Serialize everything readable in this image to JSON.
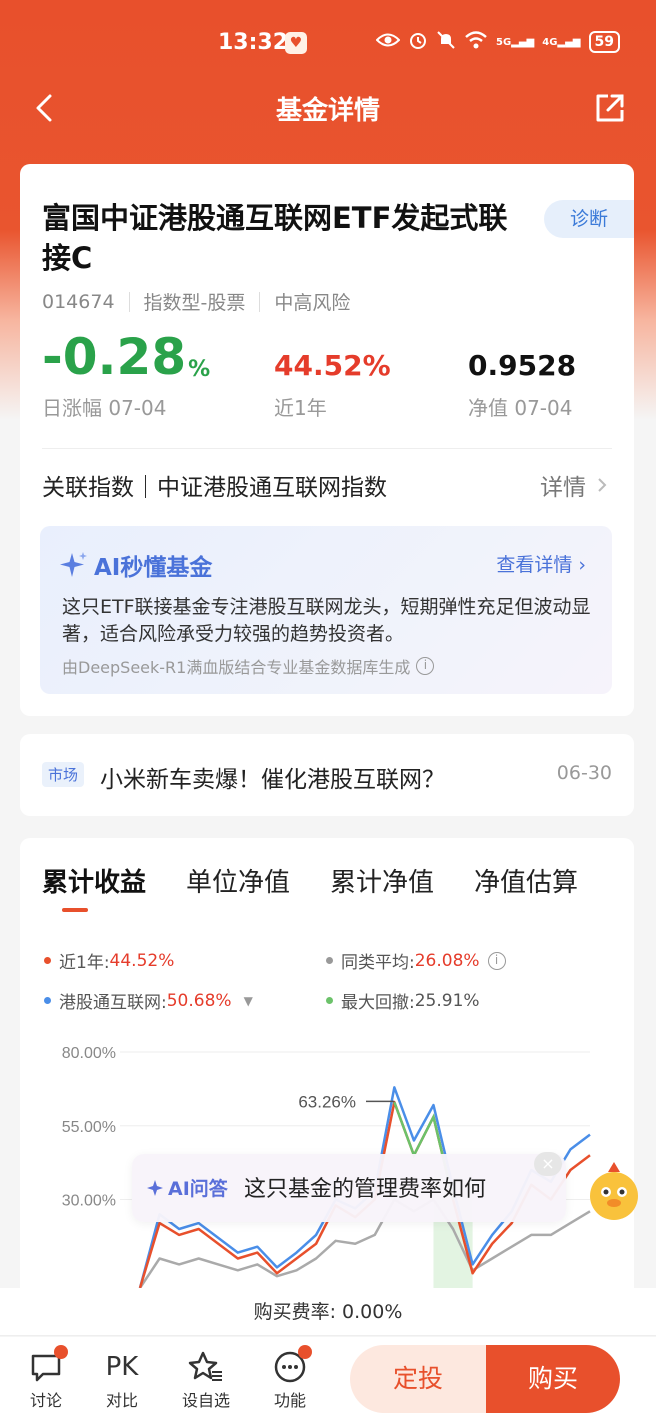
{
  "status_bar": {
    "time": "13:32",
    "battery": "59",
    "signal_1": "5G",
    "signal_2": "4G"
  },
  "header": {
    "title": "基金详情"
  },
  "fund": {
    "name": "富国中证港股通互联网ETF发起式联接C",
    "diagnose_label": "诊断",
    "code": "014674",
    "category": "指数型-股票",
    "risk": "中高风险",
    "daily_change_value": "-0.28",
    "daily_change_unit": "%",
    "daily_change_label": "日涨幅 07-04",
    "year_return": "44.52%",
    "year_return_label": "近1年",
    "nav": "0.9528",
    "nav_label": "净值 07-04",
    "index_text": "关联指数｜中证港股通互联网指数",
    "index_detail": "详情"
  },
  "ai_summary": {
    "title": "AI秒懂基金",
    "more": "查看详情",
    "text": "这只ETF联接基金专注港股互联网龙头，短期弹性充足但波动显著，适合风险承受力较强的趋势投资者。",
    "footer": "由DeepSeek-R1满血版结合专业基金数据库生成"
  },
  "news": {
    "tag": "市场",
    "title": "小米新车卖爆！催化港股互联网？",
    "date": "06-30"
  },
  "chart_tabs": [
    "累计收益",
    "单位净值",
    "累计净值",
    "净值估算"
  ],
  "legend": {
    "fund_label": "近1年:",
    "fund_value": "44.52%",
    "peer_label": "同类平均:",
    "peer_value": "26.08%",
    "index_label": "港股通互联网:",
    "index_value": "50.68%",
    "drawdown_label": "最大回撤:",
    "drawdown_value": "25.91%"
  },
  "chart_data": {
    "type": "line",
    "title": "",
    "ylim": [
      0,
      80
    ],
    "yticks": [
      "80.00%",
      "55.00%",
      "30.00%"
    ],
    "annotation": "63.26%",
    "series": [
      {
        "name": "近1年",
        "color": "#e8502c",
        "values": [
          0,
          22,
          18,
          20,
          15,
          10,
          12,
          5,
          10,
          15,
          28,
          24,
          30,
          63,
          45,
          58,
          30,
          5,
          15,
          22,
          35,
          30,
          40,
          45
        ]
      },
      {
        "name": "港股通互联网",
        "color": "#4a8ee8",
        "values": [
          0,
          25,
          20,
          22,
          17,
          12,
          14,
          7,
          12,
          18,
          30,
          27,
          33,
          68,
          50,
          62,
          34,
          8,
          18,
          26,
          40,
          36,
          47,
          52
        ]
      },
      {
        "name": "同类平均",
        "color": "#aaaaaa",
        "values": [
          0,
          10,
          8,
          10,
          8,
          6,
          8,
          4,
          6,
          10,
          16,
          15,
          18,
          30,
          26,
          30,
          20,
          6,
          10,
          14,
          18,
          18,
          22,
          26
        ]
      }
    ],
    "drawdown_color": "#6cc26a"
  },
  "ai_float": {
    "label": "AI问答",
    "text": "这只基金的管理费率如何"
  },
  "fee": {
    "text": "购买费率: 0.00%"
  },
  "bottom_nav": {
    "discuss": "讨论",
    "compare_icon_text": "PK",
    "compare": "对比",
    "watchlist": "设自选",
    "features": "功能",
    "sip": "定投",
    "buy": "购买"
  }
}
